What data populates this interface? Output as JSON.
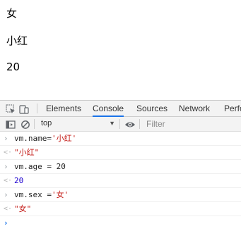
{
  "page": {
    "line1": "女",
    "line2": "小红",
    "line3": "20"
  },
  "devtools": {
    "tabs": [
      "Elements",
      "Console",
      "Sources",
      "Network",
      "Perfo"
    ],
    "active_tab": "Console",
    "context_value": "top",
    "filter_placeholder": "Filter",
    "accent_color": "#1a73e8"
  },
  "console": {
    "entries": [
      {
        "kind": "input",
        "code_prefix": "vm.name=",
        "code_string": "'小红'"
      },
      {
        "kind": "result",
        "value": "\"小红\""
      },
      {
        "kind": "input",
        "code_prefix": "vm.age = 20",
        "code_string": ""
      },
      {
        "kind": "result",
        "value": "20"
      },
      {
        "kind": "input",
        "code_prefix": "vm.sex =",
        "code_string": "'女'"
      },
      {
        "kind": "result",
        "value": "\"女\""
      }
    ]
  }
}
